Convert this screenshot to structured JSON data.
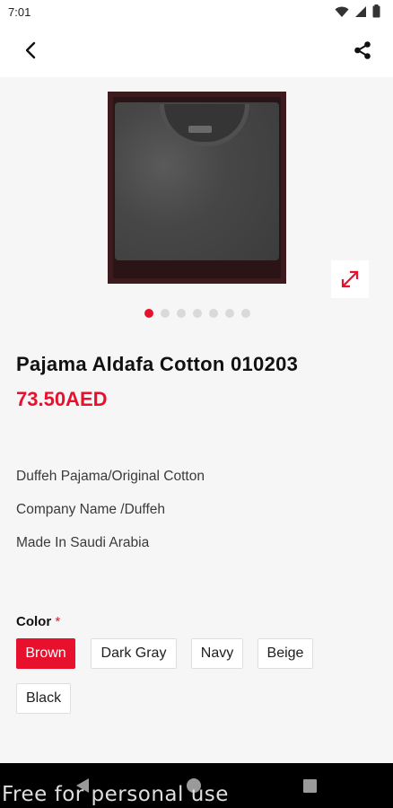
{
  "status_bar": {
    "time": "7:01"
  },
  "product": {
    "title": "Pajama Aldafa Cotton 010203",
    "price": "73.50AED",
    "image_count": 7,
    "active_image_index": 0,
    "description": [
      "Duffeh Pajama/Original Cotton",
      "Company Name /Duffeh",
      "Made In Saudi Arabia"
    ]
  },
  "color_option": {
    "label": "Color",
    "required_mark": "*",
    "options": [
      "Brown",
      "Dark Gray",
      "Navy",
      "Beige",
      "Black"
    ],
    "selected": "Brown"
  },
  "watermark": "Free for personal use",
  "colors": {
    "accent": "#e8112d",
    "background": "#f6f6f6",
    "nav_bar": "#000000"
  },
  "icons": {
    "back": "arrow-left-icon",
    "share": "share-icon",
    "expand": "expand-icon",
    "wifi": "wifi-icon",
    "signal": "signal-icon",
    "battery": "battery-icon"
  }
}
